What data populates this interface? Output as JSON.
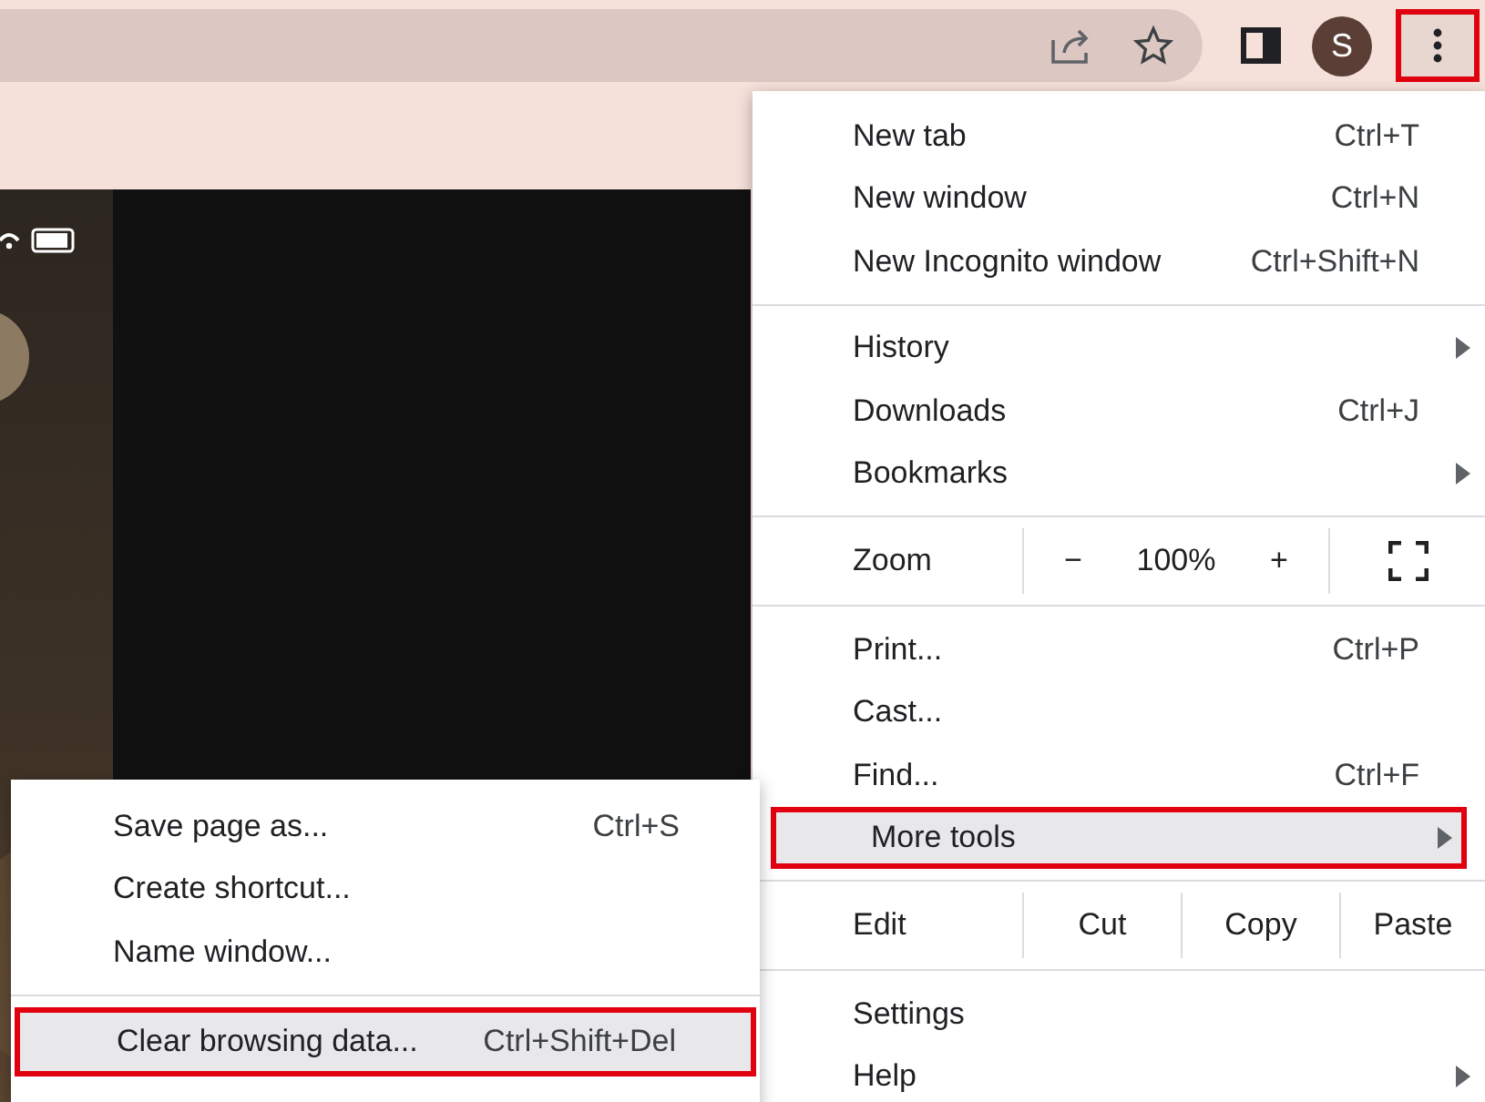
{
  "toolbar": {
    "avatar": "S",
    "menu_button": {
      "selected": true
    }
  },
  "menu": {
    "sections": [
      [
        {
          "kind": "item",
          "label": "New tab",
          "shortcut": "Ctrl+T",
          "submenu": false,
          "selected": false
        },
        {
          "kind": "item",
          "label": "New window",
          "shortcut": "Ctrl+N",
          "submenu": false,
          "selected": false
        },
        {
          "kind": "item",
          "label": "New Incognito window",
          "shortcut": "Ctrl+Shift+N",
          "submenu": false,
          "selected": false
        }
      ],
      [
        {
          "kind": "item",
          "label": "History",
          "submenu": true,
          "selected": false
        },
        {
          "kind": "item",
          "label": "Downloads",
          "shortcut": "Ctrl+J",
          "submenu": false,
          "selected": false
        },
        {
          "kind": "item",
          "label": "Bookmarks",
          "submenu": true,
          "selected": false
        }
      ],
      [
        {
          "kind": "zoom",
          "label": "Zoom",
          "minus": "−",
          "value": "100%",
          "plus": "+"
        }
      ],
      [
        {
          "kind": "item",
          "label": "Print...",
          "shortcut": "Ctrl+P",
          "submenu": false,
          "selected": false
        },
        {
          "kind": "item",
          "label": "Cast...",
          "submenu": false,
          "selected": false
        },
        {
          "kind": "item",
          "label": "Find...",
          "shortcut": "Ctrl+F",
          "submenu": false,
          "selected": false
        },
        {
          "kind": "item",
          "label": "More tools",
          "submenu": true,
          "selected": true
        }
      ],
      [
        {
          "kind": "edit",
          "label": "Edit",
          "buttons": [
            "Cut",
            "Copy",
            "Paste"
          ]
        }
      ],
      [
        {
          "kind": "item",
          "label": "Settings",
          "submenu": false,
          "selected": false
        },
        {
          "kind": "item",
          "label": "Help",
          "submenu": true,
          "selected": false
        }
      ]
    ]
  },
  "submenu": {
    "sections": [
      [
        {
          "label": "Save page as...",
          "shortcut": "Ctrl+S",
          "selected": false
        },
        {
          "label": "Create shortcut...",
          "selected": false
        },
        {
          "label": "Name window...",
          "selected": false
        }
      ],
      [
        {
          "label": "Clear browsing data...",
          "shortcut": "Ctrl+Shift+Del",
          "selected": true
        }
      ]
    ]
  }
}
